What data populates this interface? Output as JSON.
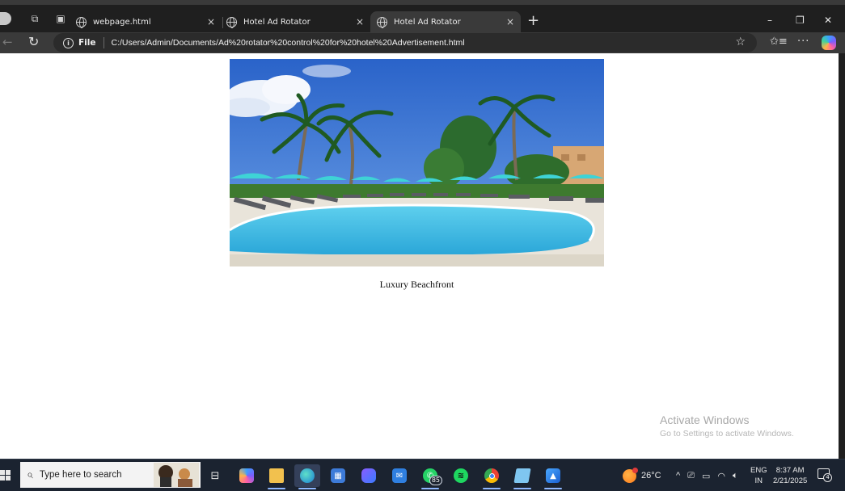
{
  "browser": {
    "tabs": [
      {
        "label": "webpage.html",
        "close": "×"
      },
      {
        "label": "Hotel Ad Rotator",
        "close": "×"
      },
      {
        "label": "Hotel Ad Rotator",
        "close": "×",
        "active": true
      }
    ],
    "new_tab": "+",
    "window_controls": {
      "minimize": "–",
      "restore": "❐",
      "close": "✕"
    },
    "address_bar": {
      "scheme_label": "File",
      "url": "C:/Users/Admin/Documents/Ad%20rotator%20control%20for%20hotel%20Advertisement.html"
    },
    "icons": [
      "profile-icon",
      "workspaces-icon",
      "tab-actions-icon",
      "back-icon",
      "reload-icon",
      "info-icon",
      "favorite-star-icon",
      "favorites-icon",
      "more-icon",
      "copilot-icon"
    ]
  },
  "page": {
    "ad": {
      "caption": "Luxury Beachfront",
      "image_subject": "resort swimming pool with palm trees and turquoise umbrellas"
    },
    "watermark": {
      "title": "Activate Windows",
      "subtitle": "Go to Settings to activate Windows."
    }
  },
  "taskbar": {
    "search_placeholder": "Type here to search",
    "apps": [
      {
        "name": "task-view",
        "running": false
      },
      {
        "name": "copilot",
        "running": false
      },
      {
        "name": "file-explorer",
        "running": true
      },
      {
        "name": "edge",
        "running": true,
        "active": true
      },
      {
        "name": "microsoft-store",
        "running": false
      },
      {
        "name": "visual-studio",
        "running": false
      },
      {
        "name": "mail",
        "running": false
      },
      {
        "name": "whatsapp",
        "running": true,
        "badge": "85"
      },
      {
        "name": "spotify",
        "running": false
      },
      {
        "name": "chrome",
        "running": true
      },
      {
        "name": "notepad",
        "running": true
      },
      {
        "name": "photos",
        "running": true
      }
    ],
    "weather": {
      "temperature": "26°C"
    },
    "tray": {
      "chevron": "^",
      "language": {
        "line1": "ENG",
        "line2": "IN"
      },
      "clock": {
        "time": "8:37 AM",
        "date": "2/21/2025"
      },
      "notification_count": "4"
    }
  },
  "colors": {
    "titlebar": "#1f1f1f",
    "toolbar": "#3a3a3a",
    "taskbar": "#1b2330",
    "page_background": "#ffffff"
  }
}
